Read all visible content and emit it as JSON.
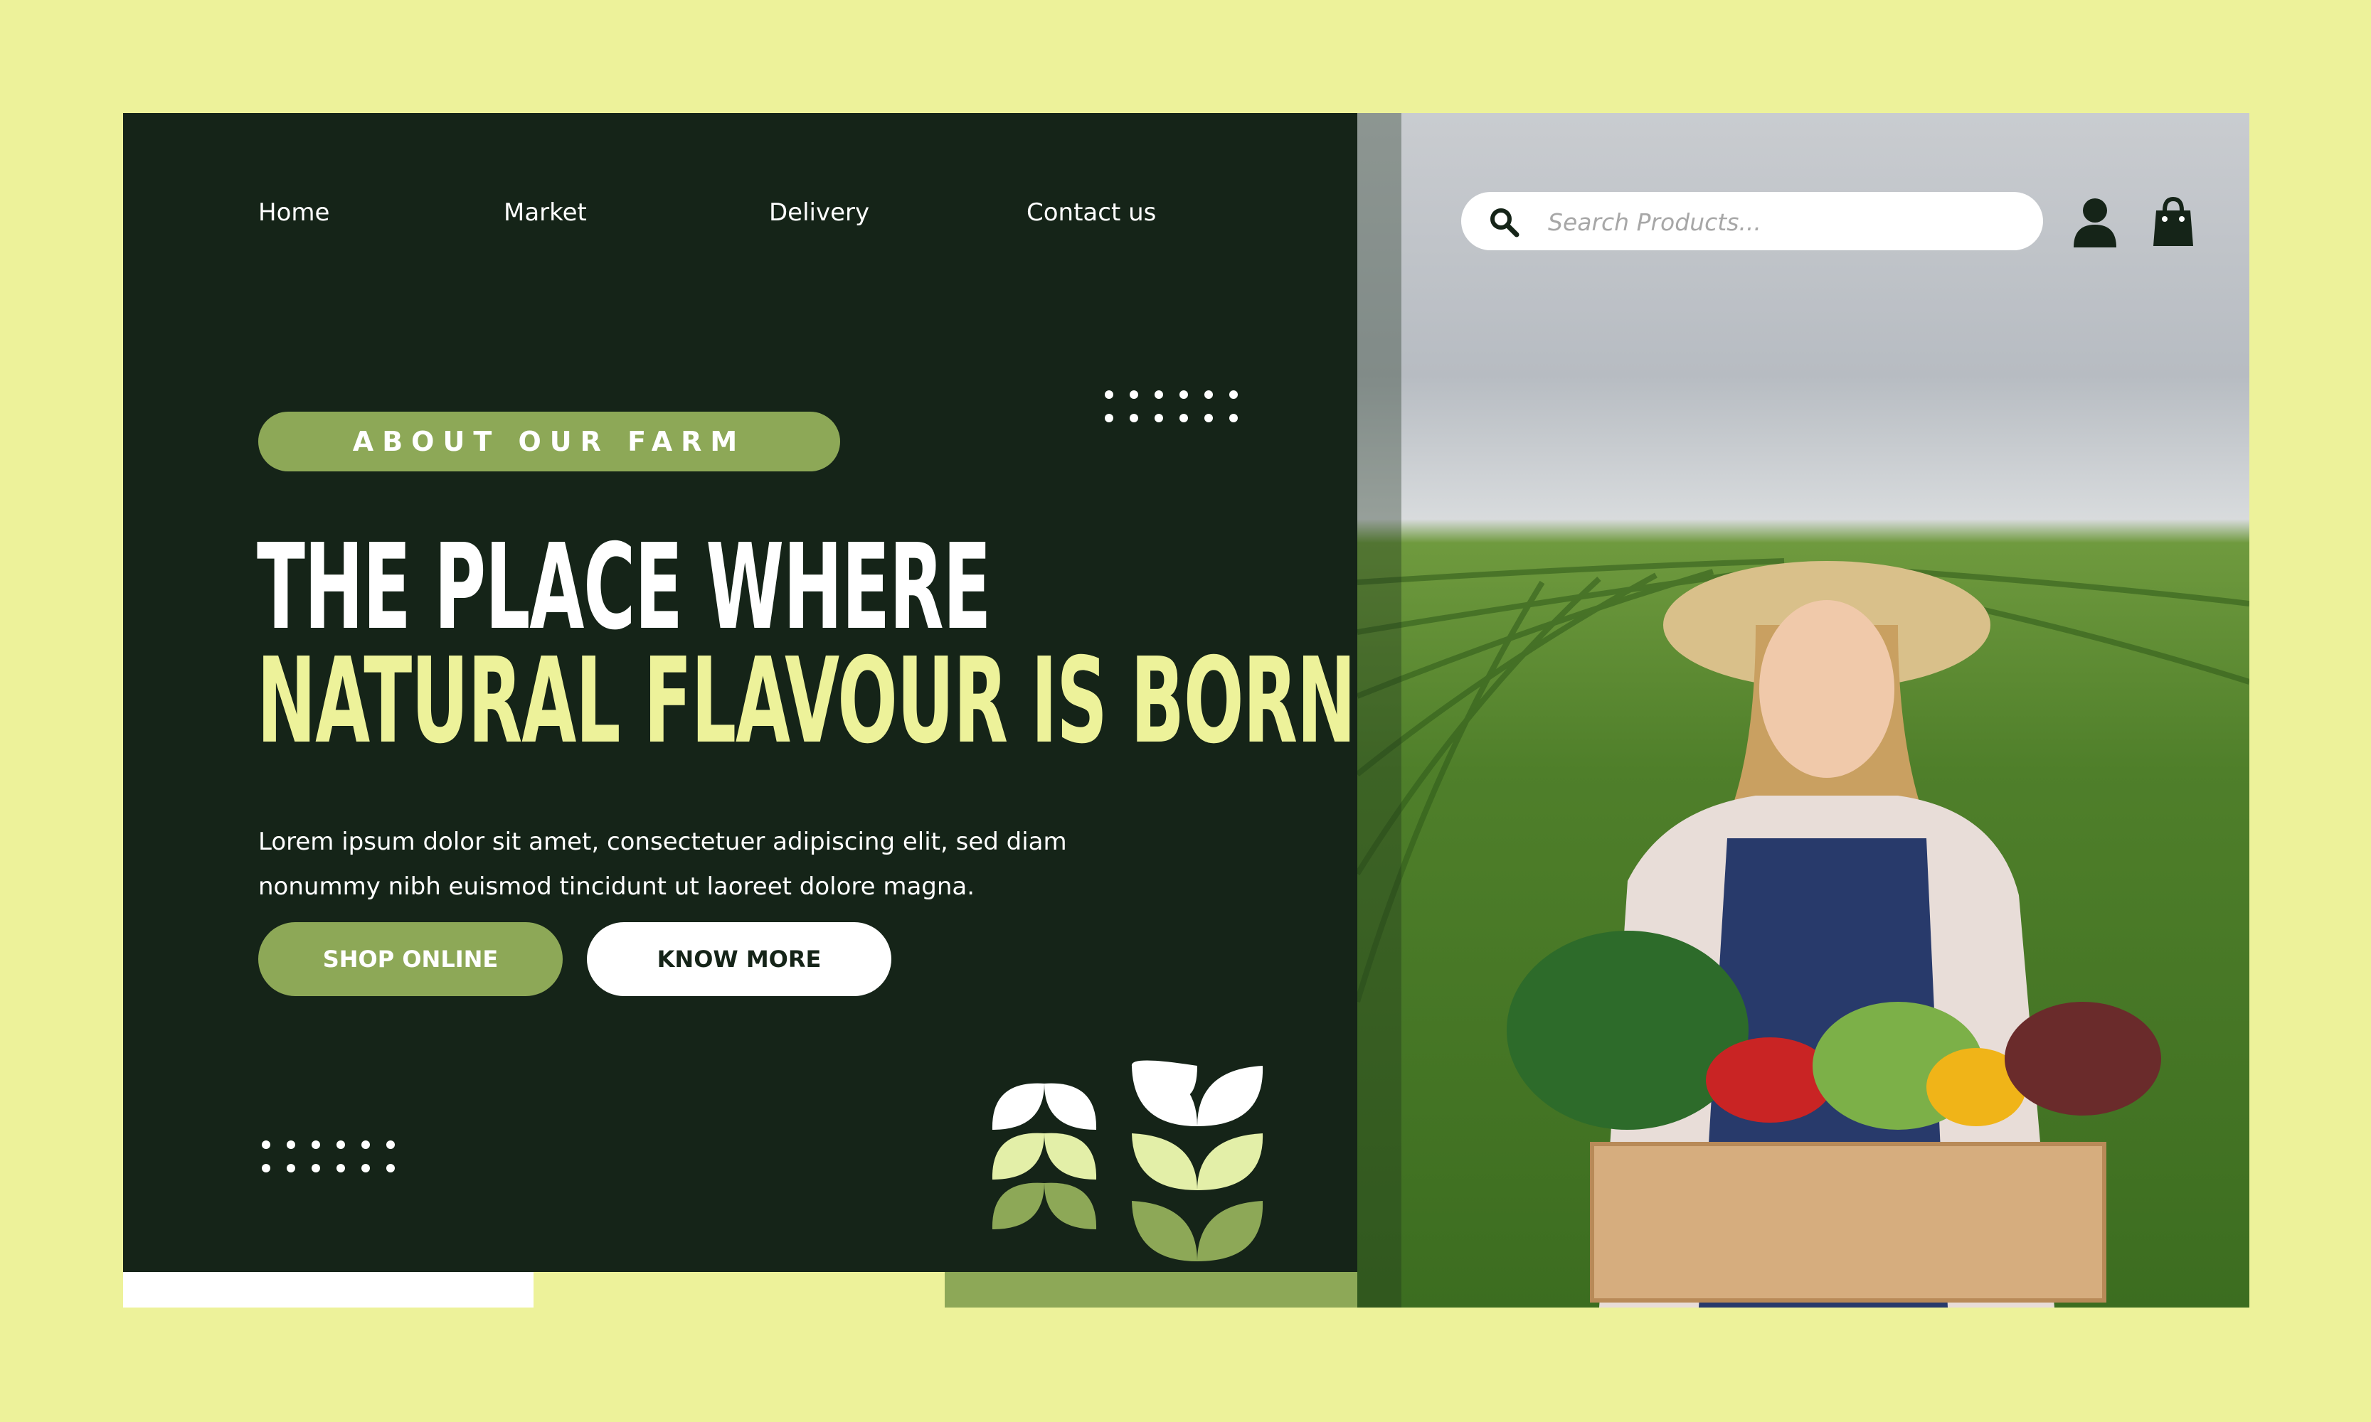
{
  "colors": {
    "background": "#EDF29A",
    "panel": "#152418",
    "accent_green": "#8DA857",
    "headline_yellow": "#EDF29A",
    "white": "#ffffff"
  },
  "nav": {
    "items": [
      {
        "label": "Home"
      },
      {
        "label": "Market"
      },
      {
        "label": "Delivery"
      },
      {
        "label": "Contact us"
      }
    ]
  },
  "hero": {
    "tag": "ABOUT OUR FARM",
    "headline_line1": "THE PLACE WHERE",
    "headline_line2": "NATURAL FLAVOUR IS BORN",
    "description": "Lorem ipsum dolor sit amet, consectetuer adipiscing elit, sed diam nonummy nibh euismod tincidunt ut laoreet dolore magna.",
    "primary_button": "SHOP ONLINE",
    "secondary_button": "KNOW MORE"
  },
  "search": {
    "placeholder": "Search Products..."
  },
  "icons": {
    "search": "search-icon",
    "user": "user-icon",
    "cart": "shopping-bag-icon",
    "plant": "leaf-sprout-icon"
  }
}
